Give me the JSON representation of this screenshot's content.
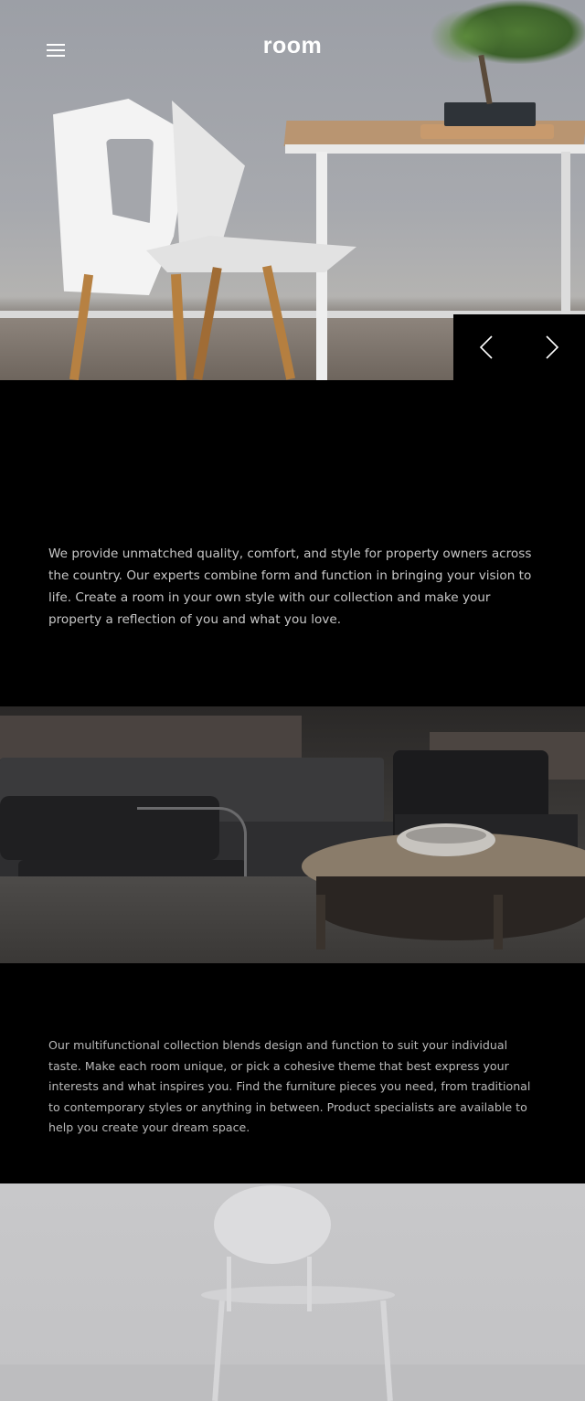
{
  "brand": {
    "logo_text": "room"
  },
  "header": {
    "menu_icon": "hamburger-menu-icon"
  },
  "hero": {
    "image_alt": "White chair beside wooden table with bonsai plant",
    "nav": {
      "prev_icon": "chevron-left-icon",
      "next_icon": "chevron-right-icon"
    }
  },
  "intro": {
    "text": "We provide unmatched quality, comfort, and style for property owners across the country. Our experts combine form and function in bringing your vision to life. Create a room in your own style with our collection and make your property a reflection of you and what you love."
  },
  "gallery": {
    "image_alt": "Dark armchairs around a round wooden coffee table"
  },
  "collection": {
    "text": "Our multifunctional collection blends design and function to suit your individual taste. Make each room unique, or pick a cohesive theme that best express your interests and what inspires you. Find the furniture pieces you need, from traditional to contemporary styles or anything in between. Product specialists are available to help you create your dream space."
  },
  "footer_image": {
    "image_alt": "White chair against a light grey wall"
  },
  "colors": {
    "background": "#000000",
    "text": "#c7c7c7",
    "logo": "#ffffff"
  }
}
